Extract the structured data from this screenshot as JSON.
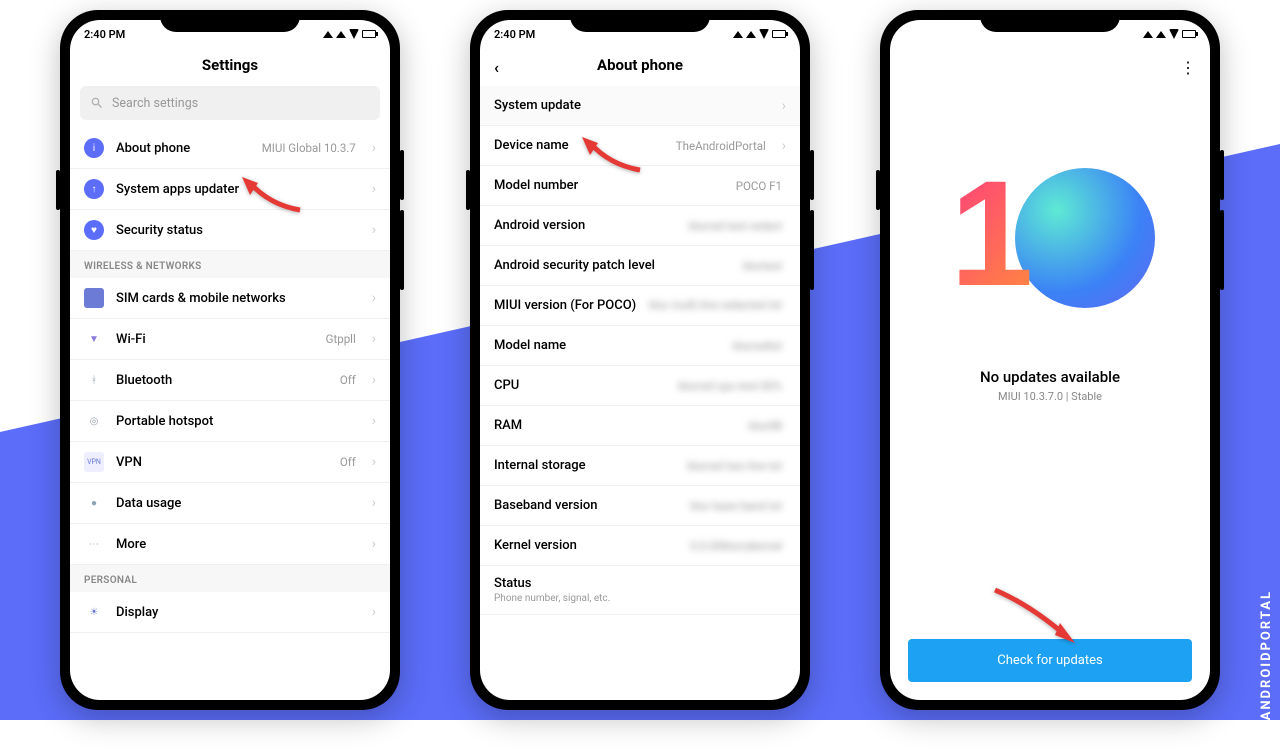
{
  "status": {
    "time": "2:40 PM"
  },
  "watermark": "THEANDROIDPORTAL",
  "screen1": {
    "title": "Settings",
    "searchPlaceholder": "Search settings",
    "rows": [
      {
        "label": "About phone",
        "value": "MIUI Global 10.3.7",
        "icon": "#5b6df9"
      },
      {
        "label": "System apps updater",
        "value": "",
        "icon": "#5b6df9"
      },
      {
        "label": "Security status",
        "value": "",
        "icon": "#5b6df9"
      }
    ],
    "section2": "WIRELESS & NETWORKS",
    "rows2": [
      {
        "label": "SIM cards & mobile networks",
        "value": "",
        "icon": "#6b7bd6"
      },
      {
        "label": "Wi-Fi",
        "value": "Gtppll",
        "icon": "#8a7bd6"
      },
      {
        "label": "Bluetooth",
        "value": "Off",
        "icon": "#9aa3b0"
      },
      {
        "label": "Portable hotspot",
        "value": "",
        "icon": "#9aa3b0"
      },
      {
        "label": "VPN",
        "value": "Off",
        "icon": "#6b7bd6"
      },
      {
        "label": "Data usage",
        "value": "",
        "icon": "#8aa3b6"
      },
      {
        "label": "More",
        "value": "",
        "icon": "#9aa3b0"
      }
    ],
    "section3": "PERSONAL",
    "rows3": [
      {
        "label": "Display",
        "value": "",
        "icon": "#6b7bd6"
      }
    ]
  },
  "screen2": {
    "title": "About phone",
    "rows": [
      {
        "label": "System update",
        "value": ""
      },
      {
        "label": "Device name",
        "value": "TheAndroidPortal"
      },
      {
        "label": "Model number",
        "value": "POCO F1"
      },
      {
        "label": "Android version",
        "value": "blurred text redact"
      },
      {
        "label": "Android security patch level",
        "value": "blurtext"
      },
      {
        "label": "MIUI version (For POCO)",
        "value": "blur multi line redacted txt"
      },
      {
        "label": "Model name",
        "value": "blurredtxt"
      },
      {
        "label": "CPU",
        "value": "blurred cpu text 00%"
      },
      {
        "label": "RAM",
        "value": "blur0B"
      },
      {
        "label": "Internal storage",
        "value": "blurred two line txt"
      },
      {
        "label": "Baseband version",
        "value": "blur base band txt"
      },
      {
        "label": "Kernel version",
        "value": "0.0.00blurrykernel"
      },
      {
        "label": "Status",
        "sub": "Phone number, signal, etc."
      }
    ]
  },
  "screen3": {
    "status": "No updates available",
    "version": "MIUI 10.3.7.0 | Stable",
    "button": "Check for updates"
  }
}
